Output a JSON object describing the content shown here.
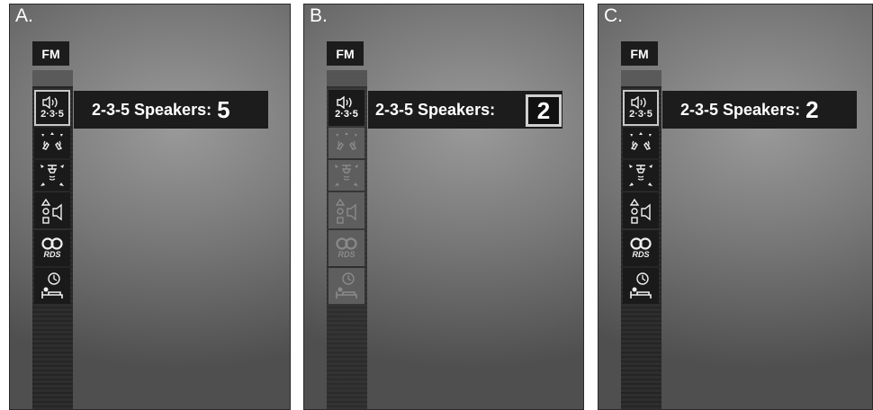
{
  "panels": [
    {
      "label": "A.",
      "source": "FM",
      "setting_label": "2-3-5 Speakers:",
      "setting_value": "5",
      "icons": [
        "speaker-2-3-5-icon",
        "surround-sound-icon",
        "sound-position-icon",
        "speaker-shapes-icon",
        "rds-icon",
        "sleep-timer-icon"
      ],
      "speaker_icon_text": "2·3·5",
      "rds_text": "RDS"
    },
    {
      "label": "B.",
      "source": "FM",
      "setting_label": "2-3-5 Speakers:",
      "setting_value": "2",
      "icons": [
        "speaker-2-3-5-icon",
        "surround-sound-icon",
        "sound-position-icon",
        "speaker-shapes-icon",
        "rds-icon",
        "sleep-timer-icon"
      ],
      "speaker_icon_text": "2·3·5",
      "rds_text": "RDS"
    },
    {
      "label": "C.",
      "source": "FM",
      "setting_label": "2-3-5 Speakers:",
      "setting_value": "2",
      "icons": [
        "speaker-2-3-5-icon",
        "surround-sound-icon",
        "sound-position-icon",
        "speaker-shapes-icon",
        "rds-icon",
        "sleep-timer-icon"
      ],
      "speaker_icon_text": "2·3·5",
      "rds_text": "RDS"
    }
  ],
  "colors": {
    "panel_dark": "#4f4f4f",
    "panel_light": "#9a9a9a",
    "menu_bg": "#1c1c1c",
    "highlight_border": "#c8c8c8"
  }
}
